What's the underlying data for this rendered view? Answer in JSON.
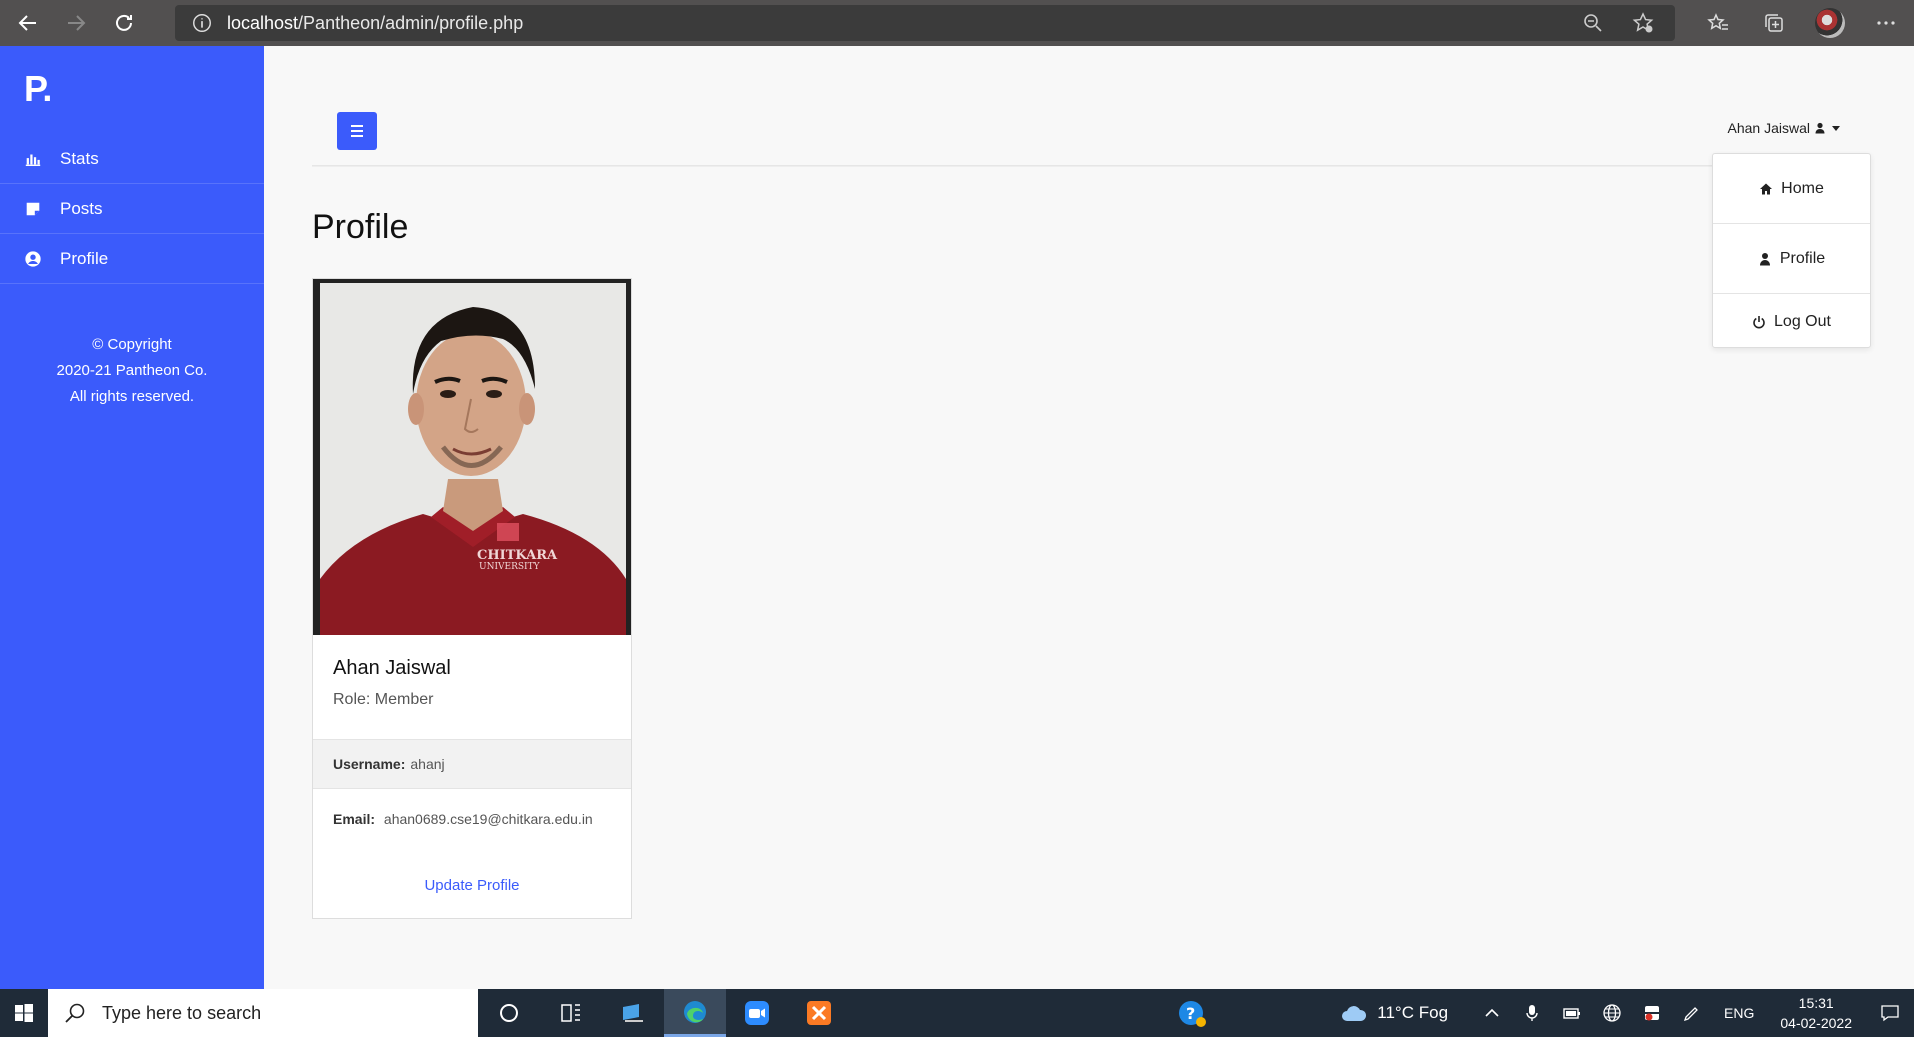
{
  "browser": {
    "url_host": "localhost",
    "url_path": "/Pantheon/admin/profile.php"
  },
  "sidebar": {
    "logo": "P.",
    "items": [
      {
        "label": "Stats",
        "icon": "bar-chart-icon"
      },
      {
        "label": "Posts",
        "icon": "sticky-note-icon"
      },
      {
        "label": "Profile",
        "icon": "user-circle-icon"
      }
    ],
    "copyright": [
      "© Copyright",
      "2020-21 Pantheon Co.",
      "All rights reserved."
    ]
  },
  "topbar": {
    "user_name": "Ahan Jaiswal"
  },
  "dropdown": {
    "items": [
      {
        "label": "Home",
        "icon": "home-icon"
      },
      {
        "label": "Profile",
        "icon": "user-icon"
      },
      {
        "label": "Log Out",
        "icon": "power-icon"
      }
    ]
  },
  "page": {
    "title": "Profile"
  },
  "card": {
    "photo_badge": "CHITKARA",
    "photo_badge_sub": "UNIVERSITY",
    "name": "Ahan Jaiswal",
    "role": "Role: Member",
    "username_label": "Username:",
    "username": "ahanj",
    "email_label": "Email:",
    "email": "ahan0689.cse19@chitkara.edu.in",
    "update_link": "Update Profile"
  },
  "taskbar": {
    "search_placeholder": "Type here to search",
    "weather": "11°C  Fog",
    "language": "ENG",
    "time": "15:31",
    "date": "04-02-2022"
  },
  "colors": {
    "accent": "#3b5bfb",
    "chrome": "#525050",
    "taskbar": "#1f2b38"
  }
}
